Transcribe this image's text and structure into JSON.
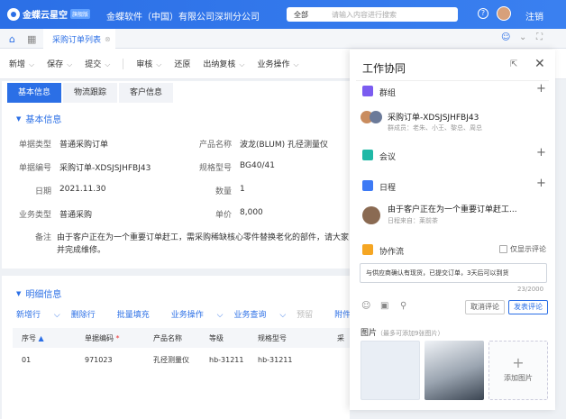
{
  "topbar": {
    "brand": "金蝶云星空",
    "brand_badge": "旗舰版",
    "company": "金蝶软件（中国）有限公司深圳分公司",
    "search_scope": "全部",
    "search_placeholder": "请输入内容进行搜索",
    "help": "?",
    "logout": "注销"
  },
  "tabbar": {
    "page_tab": "采购订单列表"
  },
  "toolbar": {
    "items": [
      "新增",
      "保存",
      "提交",
      "审核",
      "还原",
      "出纳复核",
      "业务操作"
    ]
  },
  "tabs": [
    "基本信息",
    "物流跟踪",
    "客户信息"
  ],
  "basic": {
    "title": "基本信息",
    "fields": {
      "doc_type_label": "单据类型",
      "doc_type": "普通采购订单",
      "product_name_label": "产品名称",
      "product_name": "波龙(BLUM) 孔径测量仪",
      "doc_no_label": "单据编号",
      "doc_no": "采购订单-XDSJSJHFBJ43",
      "spec_label": "规格型号",
      "spec": "BG40/41",
      "date_label": "日期",
      "date": "2021.11.30",
      "qty_label": "数量",
      "qty": "1",
      "biz_type_label": "业务类型",
      "biz_type": "普通采购",
      "price_label": "单价",
      "price": "8,000",
      "remark_label": "备注",
      "remark_1": "由于客户正在为一个重要订单赶工，需采购稀缺核心零件替换老化的部件，请大家",
      "remark_2": "并完成维修。"
    }
  },
  "detail": {
    "title": "明细信息",
    "toolbar": [
      "新增行",
      "删除行",
      "批量填充",
      "业务操作",
      "业务查询",
      "预留",
      "附件"
    ],
    "headers": [
      "序号",
      "单据编码",
      "产品名称",
      "等级",
      "规格型号",
      "采"
    ],
    "rows": [
      [
        "01",
        "971023",
        "孔径测量仪",
        "hb-31211",
        "hb-31211"
      ]
    ]
  },
  "panel": {
    "title": "工作协同",
    "group": {
      "label": "群组",
      "item_title": "采购订单-XDSJSJHFBJ43",
      "item_members": "群成员：老朱、小王、黎总、周总"
    },
    "meeting": {
      "label": "会议"
    },
    "schedule": {
      "label": "日程",
      "item_title": "由于客户正在为一个重要订单赶工...",
      "item_from": "日程来自：莱前茶"
    },
    "flow": {
      "label": "协作流",
      "only_comments": "仅显示评论",
      "comment": "与供应商确认有现货，已提交订单，3天后可以到货",
      "counter": "23/2000",
      "cancel": "取消评论",
      "submit": "发表评论"
    },
    "images": {
      "label": "图片",
      "hint": "（最多可添加9张图片）",
      "add": "添加图片"
    }
  }
}
